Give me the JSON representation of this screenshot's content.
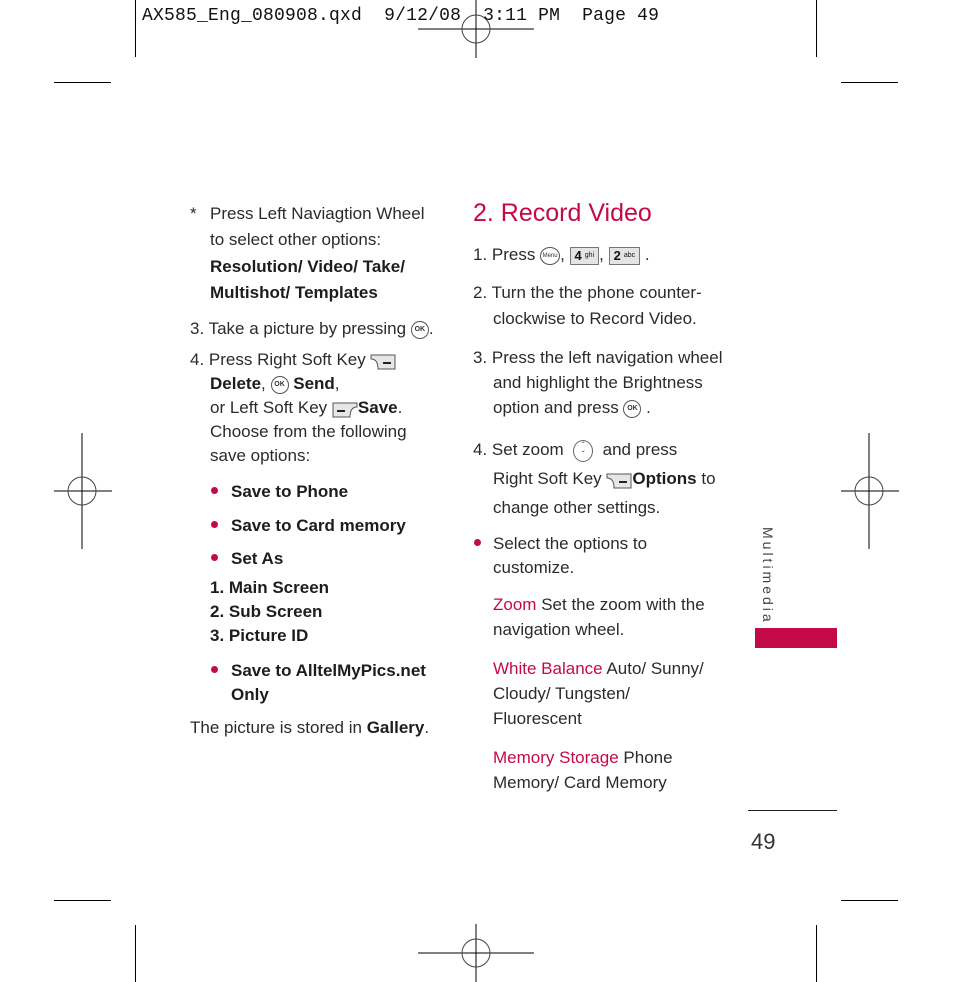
{
  "slug_line": {
    "filename": "AX585_Eng_080908.qxd",
    "date": "9/12/08",
    "time": "3:11 PM",
    "page_label": "Page 49"
  },
  "left_column": {
    "note": {
      "marker": "*",
      "line1": "Press Left Naviagtion Wheel",
      "line2": "to select other options:",
      "options_line1": "Resolution/ Video/ Take/",
      "options_line2": "Multishot/ Templates"
    },
    "step3": {
      "text": "3. Take a picture by pressing",
      "end": "."
    },
    "step4": {
      "line1": "4. Press Right Soft Key",
      "delete": "Delete",
      "comma": ",",
      "send": "Send",
      "line3_prefix": "or Left Soft Key",
      "save": "Save",
      "line4": "Choose from the following",
      "line5": "save options:"
    },
    "save_options": [
      "Save to Phone",
      "Save to Card memory",
      "Set As"
    ],
    "set_as_sub": [
      "1. Main Screen",
      "2. Sub Screen",
      "3. Picture ID"
    ],
    "alltel_option": {
      "line1": "Save to AlltelMyPics.net",
      "line2": "Only"
    },
    "stored": {
      "prefix": "The picture is stored in",
      "location": "Gallery",
      "end": "."
    }
  },
  "right_column": {
    "heading": "2. Record Video",
    "step1": {
      "prefix": "1. Press",
      "menu_icon": "Menu",
      "key1_digit": "4",
      "key1_letters": "ghi",
      "key2_digit": "2",
      "key2_letters": "abc"
    },
    "step2": {
      "line1": "2. Turn the the phone counter-",
      "line2": "clockwise to Record Video."
    },
    "step3": {
      "line1": "3. Press the left navigation wheel",
      "line2": "and highlight the Brightness",
      "line3": "option and press"
    },
    "step4": {
      "line1_prefix": "4. Set zoom",
      "line1_suffix": "and press",
      "line2_prefix": "Right Soft Key",
      "options": "Options",
      "line2_suffix": "to",
      "line3": "change other settings."
    },
    "bullet": {
      "line1": "Select the options to",
      "line2": "customize."
    },
    "settings": [
      {
        "term": "Zoom",
        "desc1": "Set the zoom with the",
        "desc2": "navigation wheel."
      },
      {
        "term": "White Balance",
        "desc1": "Auto/ Sunny/",
        "desc2": "Cloudy/ Tungsten/",
        "desc3": "Fluorescent"
      },
      {
        "term": "Memory Storage",
        "desc1": "Phone",
        "desc2": "Memory/ Card Memory"
      }
    ]
  },
  "sidebar": {
    "section_label": "Multimedia",
    "tab_color": "#c4094a"
  },
  "footer": {
    "page_number": "49"
  },
  "colors": {
    "accent": "#c4094a",
    "text": "#2b2b2b"
  },
  "icons": {
    "ok": "OK"
  }
}
